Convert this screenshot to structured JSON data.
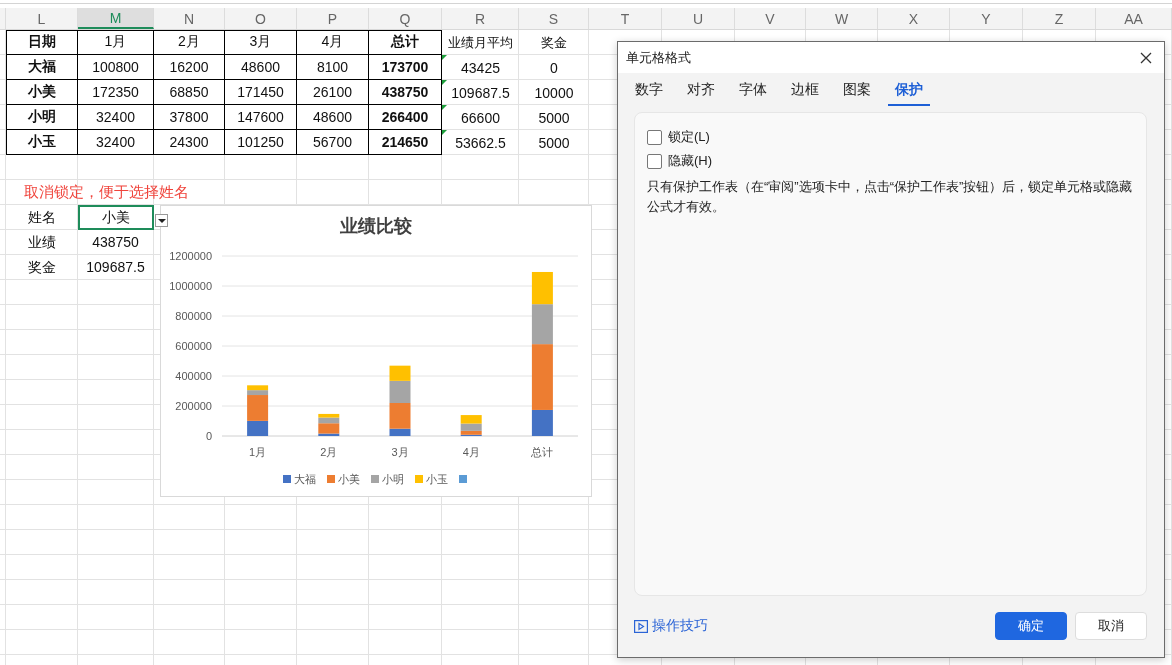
{
  "sheet": {
    "columns": [
      {
        "label": "L",
        "selected": false
      },
      {
        "label": "M",
        "selected": true
      },
      {
        "label": "N",
        "selected": false
      },
      {
        "label": "O",
        "selected": false
      },
      {
        "label": "P",
        "selected": false
      },
      {
        "label": "Q",
        "selected": false
      },
      {
        "label": "R",
        "selected": false
      },
      {
        "label": "S",
        "selected": false
      },
      {
        "label": "T",
        "selected": false
      },
      {
        "label": "U",
        "selected": false
      },
      {
        "label": "V",
        "selected": false
      },
      {
        "label": "W",
        "selected": false
      },
      {
        "label": "X",
        "selected": false
      },
      {
        "label": "Y",
        "selected": false
      },
      {
        "label": "Z",
        "selected": false
      },
      {
        "label": "AA",
        "selected": false
      }
    ],
    "table": {
      "header": [
        "日期",
        "1月",
        "2月",
        "3月",
        "4月",
        "总计"
      ],
      "rows": [
        {
          "name": "大福",
          "values": [
            "100800",
            "16200",
            "48600",
            "8100"
          ],
          "total": "173700"
        },
        {
          "name": "小美",
          "values": [
            "172350",
            "68850",
            "171450",
            "26100"
          ],
          "total": "438750"
        },
        {
          "name": "小明",
          "values": [
            "32400",
            "37800",
            "147600",
            "48600"
          ],
          "total": "266400"
        },
        {
          "name": "小玉",
          "values": [
            "32400",
            "24300",
            "101250",
            "56700"
          ],
          "total": "214650"
        }
      ]
    },
    "extra": {
      "header": [
        "业绩月平均",
        "奖金"
      ],
      "rows": [
        {
          "values": [
            "43425",
            "0"
          ],
          "flagged": true
        },
        {
          "values": [
            "109687.5",
            "10000"
          ],
          "flagged": true
        },
        {
          "values": [
            "66600",
            "5000"
          ],
          "flagged": true
        },
        {
          "values": [
            "53662.5",
            "5000"
          ],
          "flagged": true
        }
      ]
    },
    "note": "取消锁定，便于选择姓名",
    "lookup": [
      {
        "label": "姓名",
        "value": "小美",
        "selected": true
      },
      {
        "label": "业绩",
        "value": "438750",
        "selected": false
      },
      {
        "label": "奖金",
        "value": "109687.5",
        "selected": false
      }
    ]
  },
  "chart": {
    "chart_data": {
      "type": "bar",
      "title": "业绩比较",
      "stacked": true,
      "grid": true,
      "legend": true,
      "categories": [
        "1月",
        "2月",
        "3月",
        "4月",
        "总计"
      ],
      "ylim": [
        0,
        1200000
      ],
      "yticks": [
        0,
        200000,
        400000,
        600000,
        800000,
        1000000,
        1200000
      ],
      "series": [
        {
          "name": "大福",
          "color": "#4472c4",
          "values": [
            100800,
            16200,
            48600,
            8100,
            173700
          ]
        },
        {
          "name": "小美",
          "color": "#ed7d31",
          "values": [
            172350,
            68850,
            171450,
            26100,
            438750
          ]
        },
        {
          "name": "小明",
          "color": "#a5a5a5",
          "values": [
            32400,
            37800,
            147600,
            48600,
            266400
          ]
        },
        {
          "name": "小玉",
          "color": "#ffc000",
          "values": [
            32400,
            24300,
            101250,
            56700,
            214650
          ]
        },
        {
          "color": "#5b9bd5",
          "values": [
            null,
            null,
            null,
            null,
            null
          ]
        }
      ]
    }
  },
  "dialog": {
    "title": "单元格格式",
    "tabs": [
      {
        "label": "数字",
        "selected": false
      },
      {
        "label": "对齐",
        "selected": false
      },
      {
        "label": "字体",
        "selected": false
      },
      {
        "label": "边框",
        "selected": false
      },
      {
        "label": "图案",
        "selected": false
      },
      {
        "label": "保护",
        "selected": true
      }
    ],
    "options": [
      {
        "label": "锁定(L)",
        "checked": false
      },
      {
        "label": "隐藏(H)",
        "checked": false
      }
    ],
    "description": "只有保护工作表（在“审阅”选项卡中，点击“保护工作表”按钮）后，锁定单元格或隐藏公式才有效。",
    "help_link": "操作技巧",
    "buttons": [
      {
        "label": "确定",
        "kind": "primary"
      },
      {
        "label": "取消",
        "kind": "secondary"
      }
    ]
  }
}
